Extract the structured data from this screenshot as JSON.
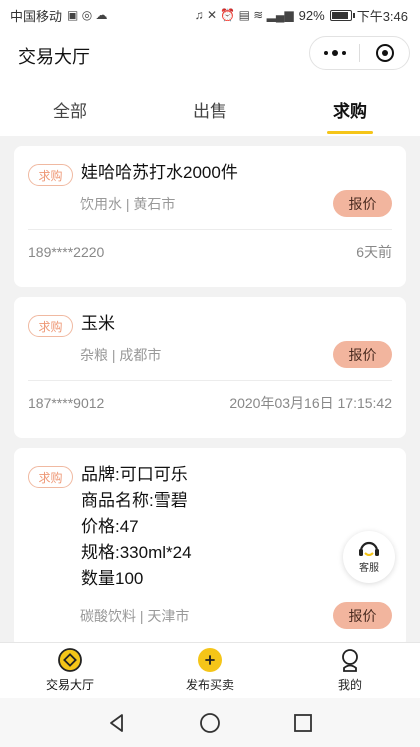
{
  "status_bar": {
    "carrier": "中国移动",
    "battery": "92%",
    "time": "下午3:46"
  },
  "header": {
    "title": "交易大厅"
  },
  "tabs": [
    {
      "label": "全部",
      "active": false
    },
    {
      "label": "出售",
      "active": false
    },
    {
      "label": "求购",
      "active": true
    }
  ],
  "cards": [
    {
      "tag": "求购",
      "title_lines": [
        "娃哈哈苏打水2000件"
      ],
      "sub": "饮用水 | 黄石市",
      "button": "报价",
      "phone": "189****2220",
      "time": "6天前"
    },
    {
      "tag": "求购",
      "title_lines": [
        "玉米"
      ],
      "sub": "杂粮 | 成都市",
      "button": "报价",
      "phone": "187****9012",
      "time": "2020年03月16日 17:15:42"
    },
    {
      "tag": "求购",
      "title_lines": [
        "品牌:可口可乐",
        "商品名称:雪碧",
        "价格:47",
        "规格:330ml*24",
        "数量100"
      ],
      "sub": "碳酸饮料 | 天津市",
      "button": "报价"
    }
  ],
  "service": {
    "label": "客服"
  },
  "tabbar": [
    {
      "label": "交易大厅",
      "icon": "hall-icon",
      "active": true
    },
    {
      "label": "发布买卖",
      "icon": "plus-icon",
      "active": false
    },
    {
      "label": "我的",
      "icon": "user-icon",
      "active": false
    }
  ],
  "colors": {
    "accent": "#f5c518",
    "tag_border": "#f0b9a1",
    "button_bg": "#f2b59e"
  }
}
